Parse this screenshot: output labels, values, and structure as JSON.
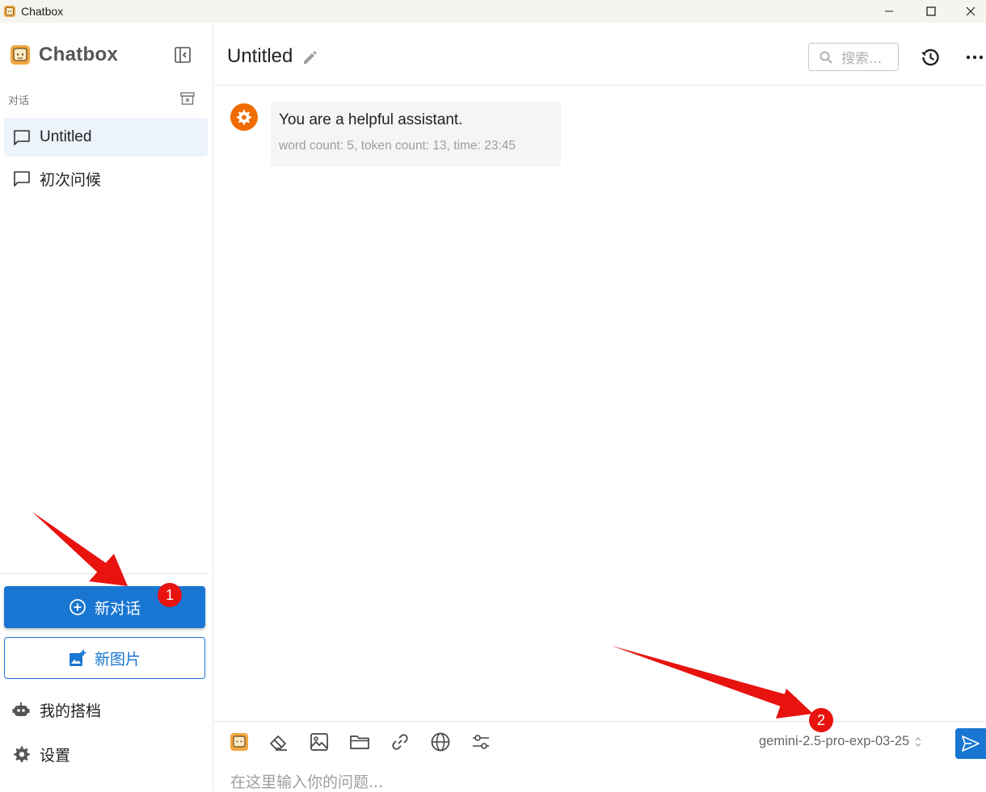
{
  "window": {
    "title": "Chatbox"
  },
  "sidebar": {
    "brand": "Chatbox",
    "section_label": "对话",
    "conversations": [
      {
        "label": "Untitled",
        "active": true
      },
      {
        "label": "初次问候",
        "active": false
      }
    ],
    "new_chat_label": "新对话",
    "new_image_label": "新图片",
    "links": [
      {
        "label": "我的搭档",
        "icon": "robot-icon"
      },
      {
        "label": "设置",
        "icon": "gear-icon"
      }
    ]
  },
  "header": {
    "title": "Untitled",
    "search_placeholder": "搜索..."
  },
  "messages": [
    {
      "role": "system",
      "text": "You are a helpful assistant.",
      "meta": "word count: 5, token count: 13, time: 23:45"
    }
  ],
  "input": {
    "model": "gemini-2.5-pro-exp-03-25",
    "placeholder": "在这里输入你的问题..."
  },
  "annotations": [
    {
      "label": "1"
    },
    {
      "label": "2"
    }
  ],
  "colors": {
    "primary": "#1976d2",
    "system_avatar": "#ef6c00",
    "annotation": "#e8130f"
  }
}
